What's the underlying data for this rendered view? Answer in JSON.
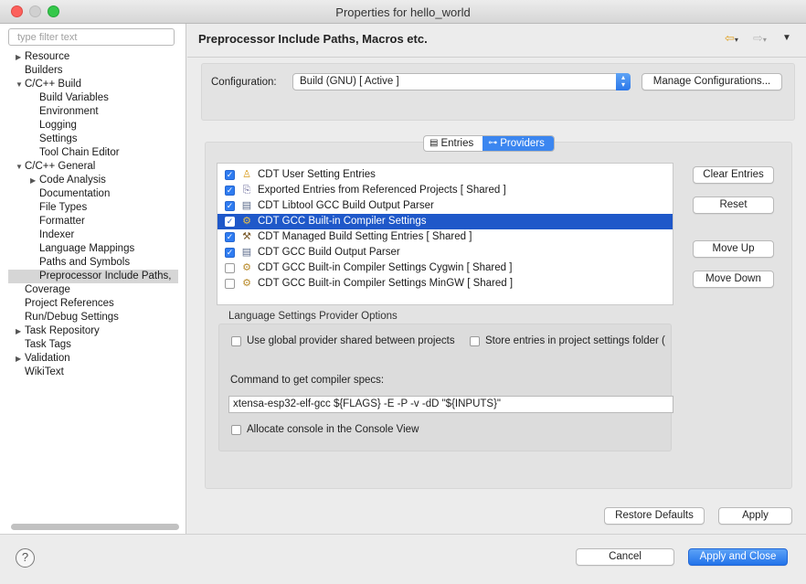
{
  "window": {
    "title": "Properties for hello_world"
  },
  "sidebar": {
    "filter_placeholder": "type filter text",
    "items": [
      {
        "label": "Resource",
        "twisty": "collapsed"
      },
      {
        "label": "Builders"
      },
      {
        "label": "C/C++ Build",
        "twisty": "expanded"
      },
      {
        "label": "Build Variables"
      },
      {
        "label": "Environment"
      },
      {
        "label": "Logging"
      },
      {
        "label": "Settings"
      },
      {
        "label": "Tool Chain Editor"
      },
      {
        "label": "C/C++ General",
        "twisty": "expanded"
      },
      {
        "label": "Code Analysis",
        "twisty": "collapsed"
      },
      {
        "label": "Documentation"
      },
      {
        "label": "File Types"
      },
      {
        "label": "Formatter"
      },
      {
        "label": "Indexer"
      },
      {
        "label": "Language Mappings"
      },
      {
        "label": "Paths and Symbols"
      },
      {
        "label": "Preprocessor Include Paths,",
        "selected": true
      },
      {
        "label": "Coverage"
      },
      {
        "label": "Project References"
      },
      {
        "label": "Run/Debug Settings"
      },
      {
        "label": "Task Repository",
        "twisty": "collapsed"
      },
      {
        "label": "Task Tags"
      },
      {
        "label": "Validation",
        "twisty": "collapsed"
      },
      {
        "label": "WikiText"
      }
    ]
  },
  "page": {
    "title": "Preprocessor Include Paths, Macros etc.",
    "nav_icons": [
      "back-arrow-icon",
      "forward-arrow-icon",
      "menu-triangle-icon"
    ]
  },
  "configuration": {
    "label": "Configuration:",
    "selected": "Build (GNU)  [ Active ]",
    "manage_button": "Manage Configurations..."
  },
  "tabs": [
    {
      "label": "Entries",
      "active": false,
      "icon": "entries-icon"
    },
    {
      "label": "Providers",
      "active": true,
      "icon": "providers-icon"
    }
  ],
  "providers": [
    {
      "label": "CDT User Setting Entries",
      "checked": true,
      "icon": "user-icon"
    },
    {
      "label": "Exported Entries from Referenced Projects   [ Shared ]",
      "checked": true,
      "icon": "exported-icon"
    },
    {
      "label": "CDT Libtool GCC Build Output Parser",
      "checked": true,
      "icon": "parser-icon"
    },
    {
      "label": "CDT GCC Built-in Compiler Settings",
      "checked": true,
      "icon": "builtin-icon",
      "selected": true
    },
    {
      "label": "CDT Managed Build Setting Entries   [ Shared ]",
      "checked": true,
      "icon": "managed-icon"
    },
    {
      "label": "CDT GCC Build Output Parser",
      "checked": true,
      "icon": "parser-icon"
    },
    {
      "label": "CDT GCC Built-in Compiler Settings Cygwin   [ Shared ]",
      "checked": false,
      "icon": "builtin-icon"
    },
    {
      "label": "CDT GCC Built-in Compiler Settings MinGW   [ Shared ]",
      "checked": false,
      "icon": "builtin-icon"
    }
  ],
  "side_buttons": {
    "clear": "Clear Entries",
    "reset": "Reset",
    "move_up": "Move Up",
    "move_down": "Move Down"
  },
  "options": {
    "group_label": "Language Settings Provider Options",
    "use_global": "Use global provider shared between projects",
    "store_entries": "Store entries in project settings folder (",
    "command_label": "Command to get compiler specs:",
    "command_value": "xtensa-esp32-elf-gcc ${FLAGS} -E -P -v -dD \"${INPUTS}\"",
    "allocate_console": "Allocate console in the Console View"
  },
  "buttons": {
    "restore_defaults": "Restore Defaults",
    "apply": "Apply",
    "cancel": "Cancel",
    "apply_close": "Apply and Close"
  },
  "colors": {
    "selection": "#1f58c9",
    "accent": "#3b86f0",
    "tree_selection": "#d6d6d6"
  }
}
